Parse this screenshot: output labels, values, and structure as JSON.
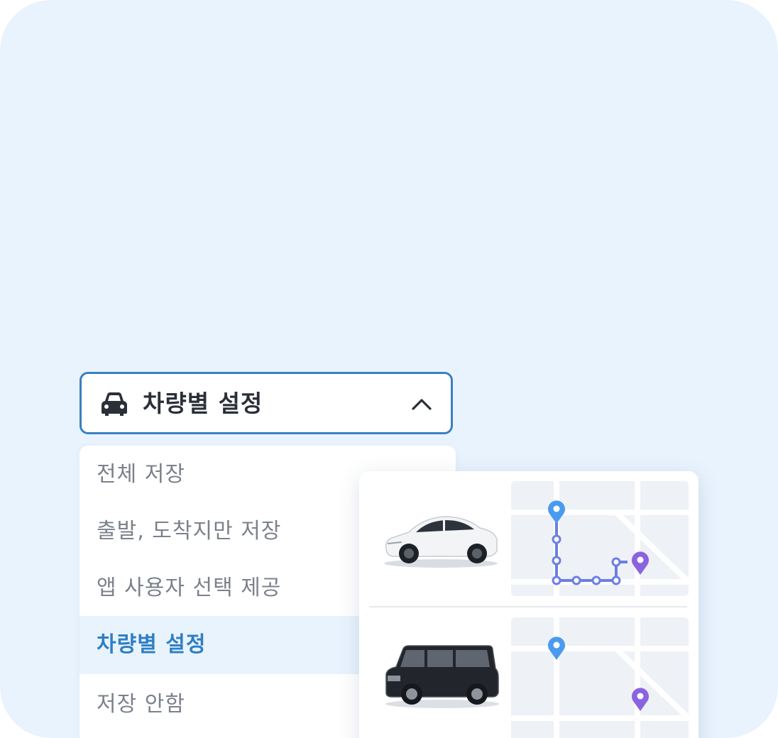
{
  "dropdown": {
    "selected_label": "차량별 설정",
    "icon": "car-icon",
    "toggle_icon": "chevron-up-icon",
    "border_color": "#3a80c2"
  },
  "menu": {
    "items": [
      {
        "label": "전체 저장",
        "selected": false
      },
      {
        "label": "출발, 도착지만 저장",
        "selected": false
      },
      {
        "label": "앱 사용자 선택 제공",
        "selected": false
      },
      {
        "label": "차량별 설정",
        "selected": true
      },
      {
        "label": "저장 안함",
        "selected": false
      }
    ],
    "selected_color": "#2f7fc4"
  },
  "vehicles": [
    {
      "image": "white-suv-image",
      "map": "route-map-full"
    },
    {
      "image": "black-suv-image",
      "map": "route-map-endpoints-only"
    }
  ],
  "colors": {
    "background": "#e9f3fe",
    "start_pin": "#4a9bf0",
    "end_pin": "#8a63e0"
  }
}
